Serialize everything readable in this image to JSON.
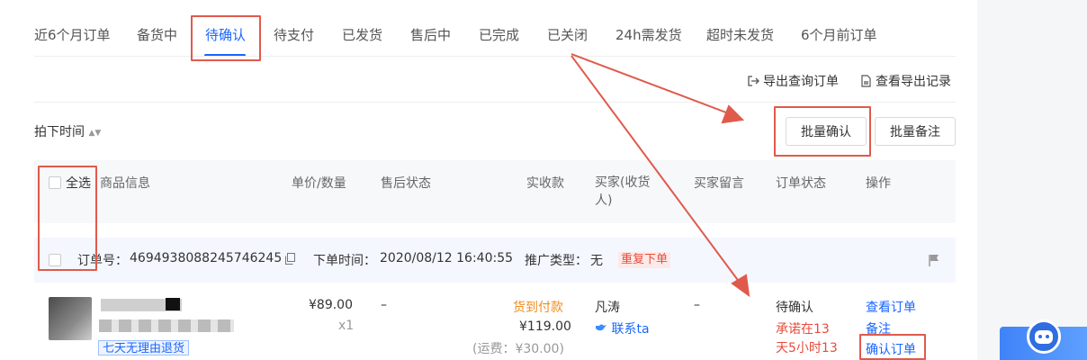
{
  "tabs": [
    {
      "label": "近6个月订单"
    },
    {
      "label": "备货中"
    },
    {
      "label": "待确认"
    },
    {
      "label": "待支付"
    },
    {
      "label": "已发货"
    },
    {
      "label": "售后中"
    },
    {
      "label": "已完成"
    },
    {
      "label": "已关闭"
    },
    {
      "label": "24h需发货"
    },
    {
      "label": "超时未发货"
    },
    {
      "label": "6个月前订单"
    }
  ],
  "toolbar": {
    "export_query": "导出查询订单",
    "view_export": "查看导出记录"
  },
  "sort": {
    "label": "拍下时间"
  },
  "actions": {
    "batch_confirm": "批量确认",
    "batch_remark": "批量备注"
  },
  "columns": {
    "select_all": "全选",
    "product": "商品信息",
    "price_qty": "单价/数量",
    "after_sale": "售后状态",
    "received": "实收款",
    "buyer": "买家(收货人)",
    "buyer_msg": "买家留言",
    "order_status": "订单状态",
    "ops": "操作"
  },
  "order": {
    "id_label": "订单号：",
    "id": "4694938088245746245",
    "time_label": "下单时间：",
    "time": "2020/08/12 16:40:55",
    "promo_label": "推广类型：",
    "promo": "无",
    "tag": "重复下单",
    "return_badge": "七天无理由退货",
    "price": "¥89.00",
    "qty": "x1",
    "after_sale": "–",
    "pay_method": "货到付款",
    "amount": "¥119.00",
    "shipping": "(运费：¥30.00)",
    "buyer_name": "凡涛",
    "contact": "联系ta",
    "buyer_msg": "–",
    "status": "待确认",
    "promise_line1": "承诺在13",
    "promise_line2": "天5小时13",
    "op_view": "查看订单",
    "op_remark": "备注",
    "op_confirm": "确认订单"
  }
}
